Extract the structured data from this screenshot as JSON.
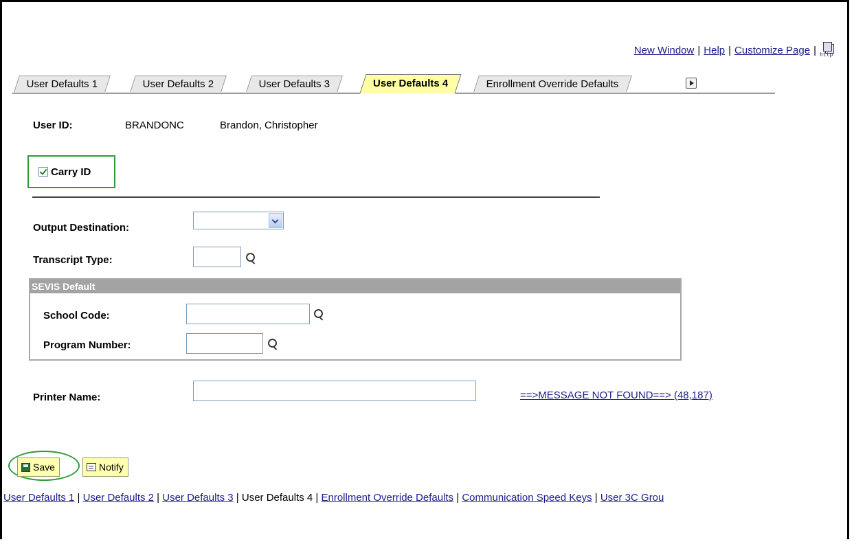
{
  "header": {
    "links": [
      "New Window",
      "Help",
      "Customize Page"
    ],
    "http_icon_text": "http",
    "icon": "http-page-icon"
  },
  "tabs": [
    {
      "label": "User Defaults 1",
      "active": false
    },
    {
      "label": "User Defaults 2",
      "active": false
    },
    {
      "label": "User Defaults 3",
      "active": false
    },
    {
      "label": "User Defaults 4",
      "active": true
    },
    {
      "label": "Enrollment Override Defaults",
      "active": false
    }
  ],
  "user": {
    "label": "User ID:",
    "id": "BRANDONC",
    "name": "Brandon, Christopher"
  },
  "carry_id": {
    "label": "Carry ID",
    "checked": true
  },
  "fields": {
    "output_destination": {
      "label": "Output Destination:",
      "value": ""
    },
    "transcript_type": {
      "label": "Transcript Type:",
      "value": ""
    },
    "printer_name": {
      "label": "Printer Name:",
      "value": ""
    }
  },
  "sevis": {
    "title": "SEVIS Default",
    "school_code": {
      "label": "School Code:",
      "value": ""
    },
    "program_number": {
      "label": "Program Number:",
      "value": ""
    }
  },
  "message_link": "==>MESSAGE NOT FOUND==> (48,187)",
  "buttons": {
    "save": "Save",
    "notify": "Notify"
  },
  "bottom_nav": [
    {
      "label": "User Defaults 1",
      "link": true
    },
    {
      "label": "User Defaults 2",
      "link": true
    },
    {
      "label": "User Defaults 3",
      "link": true
    },
    {
      "label": "User Defaults 4",
      "link": false
    },
    {
      "label": "Enrollment Override Defaults",
      "link": true
    },
    {
      "label": "Communication Speed Keys",
      "link": true
    },
    {
      "label": "User 3C Grou",
      "link": true
    }
  ],
  "colors": {
    "active_tab": "#ffffa6",
    "highlight": "#2e9a3a",
    "button": "#ffffb0",
    "section_header": "#a3a3a3"
  }
}
